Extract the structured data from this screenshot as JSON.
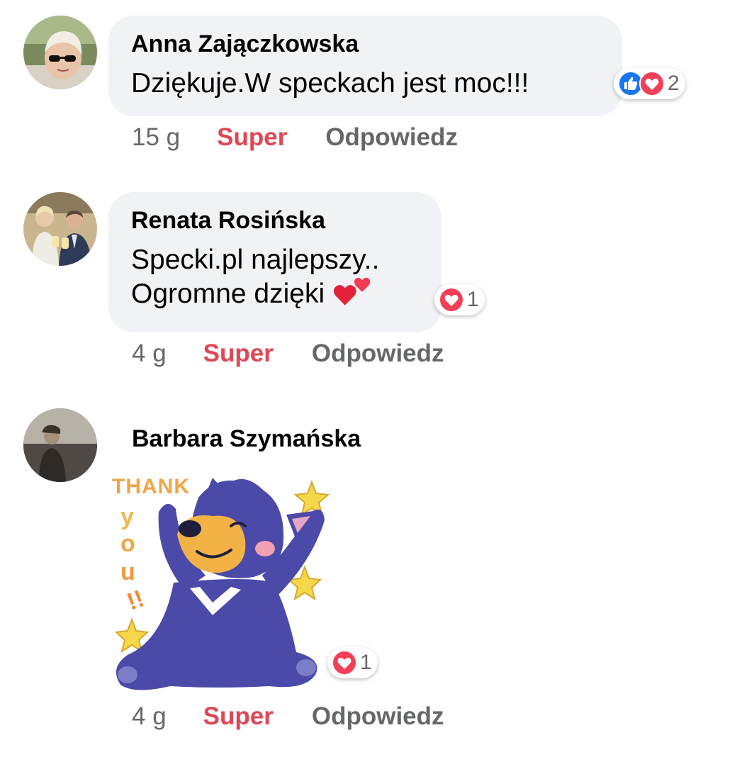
{
  "comments": [
    {
      "author": "Anna Zajączkowska",
      "text": "Dziękuje.W speckach jest moc!!!",
      "reaction_count": "2",
      "reactions": [
        "like-icon",
        "love-icon"
      ],
      "time": "15 g",
      "action_super": "Super",
      "action_reply": "Odpowiedz"
    },
    {
      "author": "Renata Rosińska",
      "text_line1": "Specki.pl najlepszy..",
      "text_line2": "Ogromne dzięki",
      "reaction_count": "1",
      "reactions": [
        "love-icon"
      ],
      "time": "4 g",
      "action_super": "Super",
      "action_reply": "Odpowiedz"
    },
    {
      "author": "Barbara Szymańska",
      "sticker": "thank-you-bear-sticker",
      "sticker_text": "THANK YOU!!",
      "reaction_count": "1",
      "reactions": [
        "love-icon"
      ],
      "time": "4 g",
      "action_super": "Super",
      "action_reply": "Odpowiedz"
    }
  ],
  "colors": {
    "bubble_bg": "#f0f2f5",
    "super_red": "#e04654",
    "meta_gray": "#65676b",
    "like_blue": "#1877f2",
    "love_red": "#f33e58"
  }
}
